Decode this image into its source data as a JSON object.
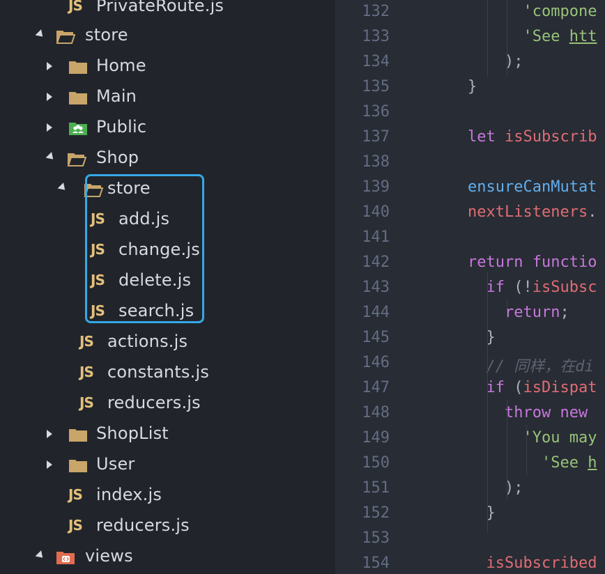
{
  "sidebar": {
    "items": [
      {
        "label": "PrivateRoute.js",
        "type": "js"
      },
      {
        "label": "store",
        "type": "folder-open"
      },
      {
        "label": "Home",
        "type": "folder-closed"
      },
      {
        "label": "Main",
        "type": "folder-closed"
      },
      {
        "label": "Public",
        "type": "folder-public"
      },
      {
        "label": "Shop",
        "type": "folder-open"
      },
      {
        "label": "store",
        "type": "folder-open"
      },
      {
        "label": "add.js",
        "type": "js"
      },
      {
        "label": "change.js",
        "type": "js"
      },
      {
        "label": "delete.js",
        "type": "js"
      },
      {
        "label": "search.js",
        "type": "js"
      },
      {
        "label": "actions.js",
        "type": "js"
      },
      {
        "label": "constants.js",
        "type": "js"
      },
      {
        "label": "reducers.js",
        "type": "js"
      },
      {
        "label": "ShopList",
        "type": "folder-closed"
      },
      {
        "label": "User",
        "type": "folder-closed"
      },
      {
        "label": "index.js",
        "type": "js"
      },
      {
        "label": "reducers.js",
        "type": "js"
      },
      {
        "label": "views",
        "type": "folder-views"
      }
    ],
    "js_badge": "JS"
  },
  "editor": {
    "line_numbers": [
      "132",
      "133",
      "134",
      "135",
      "136",
      "137",
      "138",
      "139",
      "140",
      "141",
      "142",
      "143",
      "144",
      "145",
      "146",
      "147",
      "148",
      "149",
      "150",
      "151",
      "152",
      "153",
      "154"
    ],
    "lines": [
      {
        "indent": "      ",
        "parts": [
          [
            "str",
            "'compone"
          ]
        ]
      },
      {
        "indent": "      ",
        "parts": [
          [
            "str",
            "'See "
          ],
          [
            "str u",
            "htt"
          ]
        ]
      },
      {
        "indent": "    ",
        "parts": [
          [
            "punc",
            ");"
          ]
        ]
      },
      {
        "indent": "",
        "parts": [
          [
            "punc",
            "}"
          ]
        ]
      },
      {
        "indent": "",
        "parts": []
      },
      {
        "indent": "",
        "parts": [
          [
            "kw",
            "let "
          ],
          [
            "var",
            "isSubscrib"
          ]
        ]
      },
      {
        "indent": "",
        "parts": []
      },
      {
        "indent": "",
        "parts": [
          [
            "fn",
            "ensureCanMutat"
          ]
        ]
      },
      {
        "indent": "",
        "parts": [
          [
            "var",
            "nextListeners"
          ],
          [
            "punc",
            "."
          ]
        ]
      },
      {
        "indent": "",
        "parts": []
      },
      {
        "indent": "",
        "parts": [
          [
            "kw",
            "return "
          ],
          [
            "kw",
            "functio"
          ]
        ]
      },
      {
        "indent": "  ",
        "parts": [
          [
            "kw",
            "if "
          ],
          [
            "punc",
            "(!"
          ],
          [
            "var",
            "isSubsc"
          ]
        ]
      },
      {
        "indent": "    ",
        "parts": [
          [
            "kw",
            "return"
          ],
          [
            "punc",
            ";"
          ]
        ]
      },
      {
        "indent": "  ",
        "parts": [
          [
            "punc",
            "}"
          ]
        ]
      },
      {
        "indent": "  ",
        "parts": [
          [
            "cm",
            "// 同样，在di"
          ]
        ]
      },
      {
        "indent": "  ",
        "parts": [
          [
            "kw",
            "if "
          ],
          [
            "punc",
            "("
          ],
          [
            "var",
            "isDispat"
          ]
        ]
      },
      {
        "indent": "    ",
        "parts": [
          [
            "kw",
            "throw "
          ],
          [
            "kw",
            "new "
          ]
        ]
      },
      {
        "indent": "      ",
        "parts": [
          [
            "str",
            "'You may"
          ]
        ]
      },
      {
        "indent": "        ",
        "parts": [
          [
            "str",
            "'See "
          ],
          [
            "str u",
            "h"
          ]
        ]
      },
      {
        "indent": "    ",
        "parts": [
          [
            "punc",
            ");"
          ]
        ]
      },
      {
        "indent": "  ",
        "parts": [
          [
            "punc",
            "}"
          ]
        ]
      },
      {
        "indent": "",
        "parts": []
      },
      {
        "indent": "  ",
        "parts": [
          [
            "var",
            "isSubscribed"
          ]
        ]
      }
    ]
  },
  "colors": {
    "accent_highlight": "#35a8e6",
    "js_icon": "#e5c07b",
    "folder": "#c9a56a",
    "public_folder": "#4caf50",
    "views_folder": "#e06c4f"
  }
}
